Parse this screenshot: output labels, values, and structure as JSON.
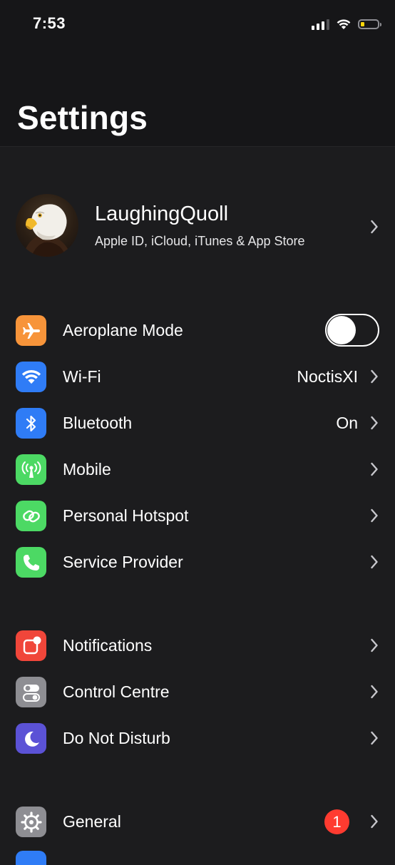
{
  "status_bar": {
    "time": "7:53",
    "icons": [
      "cellular-signal-icon",
      "wifi-icon",
      "battery-icon"
    ],
    "battery_color": "#ffd60a"
  },
  "header": {
    "title": "Settings"
  },
  "profile": {
    "name": "LaughingQuoll",
    "subtitle": "Apple ID, iCloud, iTunes & App Store",
    "avatar_icon": "eagle-avatar"
  },
  "sections": [
    {
      "rows": [
        {
          "label": "Aeroplane Mode",
          "icon": "airplane-icon",
          "color": "#f7943a",
          "toggle_on": false
        },
        {
          "label": "Wi-Fi",
          "icon": "wifi-icon",
          "color": "#2f7cf6",
          "value": "NoctisXI"
        },
        {
          "label": "Bluetooth",
          "icon": "bluetooth-icon",
          "color": "#2f7cf6",
          "value": "On"
        },
        {
          "label": "Mobile",
          "icon": "antenna-icon",
          "color": "#4cd964"
        },
        {
          "label": "Personal Hotspot",
          "icon": "hotspot-link-icon",
          "color": "#4cd964"
        },
        {
          "label": "Service Provider",
          "icon": "phone-icon",
          "color": "#4cd964"
        }
      ]
    },
    {
      "rows": [
        {
          "label": "Notifications",
          "icon": "notifications-icon",
          "color": "#f0463a"
        },
        {
          "label": "Control Centre",
          "icon": "control-centre-icon",
          "color": "#8e8e93"
        },
        {
          "label": "Do Not Disturb",
          "icon": "moon-icon",
          "color": "#5b52d6"
        }
      ]
    },
    {
      "rows": [
        {
          "label": "General",
          "icon": "gear-icon",
          "color": "#8e8e93",
          "badge": "1"
        }
      ]
    }
  ],
  "colors": {
    "background": "#1c1c1e",
    "header_background": "#161618",
    "badge": "#ff3b30",
    "chevron": "#c7c7cc"
  }
}
